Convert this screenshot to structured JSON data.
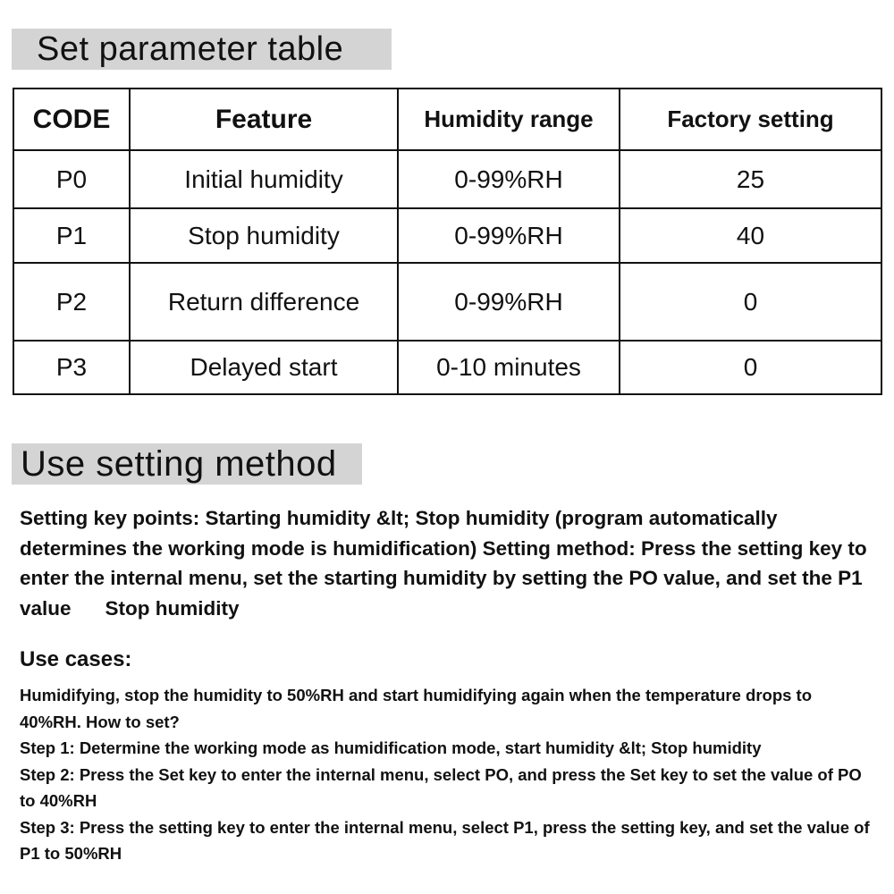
{
  "sections": {
    "parameter_table_title": "Set parameter table",
    "setting_method_title": "Use setting method"
  },
  "table": {
    "headers": [
      "CODE",
      "Feature",
      "Humidity range",
      "Factory setting"
    ],
    "rows": [
      {
        "code": "P0",
        "feature": "Initial humidity",
        "range": "0-99%RH",
        "factory": "25"
      },
      {
        "code": "P1",
        "feature": "Stop humidity",
        "range": "0-99%RH",
        "factory": "40"
      },
      {
        "code": "P2",
        "feature": "Return difference",
        "range": "0-99%RH",
        "factory": "0"
      },
      {
        "code": "P3",
        "feature": "Delayed start",
        "range": "0-10 minutes",
        "factory": "0"
      }
    ]
  },
  "method": {
    "key_points_main": "Setting key points: Starting humidity &lt; Stop humidity (program automatically determines the working mode is humidification) Setting method: Press the setting key to enter the internal menu, set the starting humidity by setting the PO value, and set the P1 value",
    "key_points_tail": "Stop humidity",
    "use_cases_heading": "Use cases:",
    "use_cases": [
      "Humidifying, stop the humidity to 50%RH and start humidifying again when the temperature drops to 40%RH. How to set?",
      "Step 1: Determine the working mode as humidification mode, start humidity &lt; Stop humidity",
      "Step 2: Press the Set key to enter the internal menu, select PO, and press the Set key to set the value of PO to 40%RH",
      "Step 3: Press the setting key to enter the internal menu, select P1, press the setting key, and set the value of P1 to 50%RH"
    ]
  }
}
